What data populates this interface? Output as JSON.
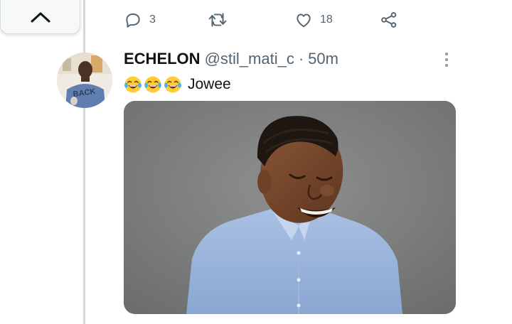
{
  "tweet_actions": {
    "reply_count": "3",
    "retweet_count": "",
    "like_count": "18"
  },
  "tweet": {
    "display_name": "ECHELON",
    "handle": "@stil_mati_c",
    "separator": "·",
    "timestamp": "50m",
    "emoji": [
      "😂",
      "😂",
      "😂"
    ],
    "text": "Jowee",
    "avatar_shirt_text": "BACK"
  },
  "icons": {
    "collapse": "chevron-up-icon",
    "reply": "reply-icon",
    "retweet": "retweet-icon",
    "like": "heart-icon",
    "share": "share-icon",
    "more": "more-vertical-icon"
  },
  "colors": {
    "secondary_text": "#536471",
    "primary_text": "#0f1419",
    "thread_line": "#cfd9de"
  }
}
